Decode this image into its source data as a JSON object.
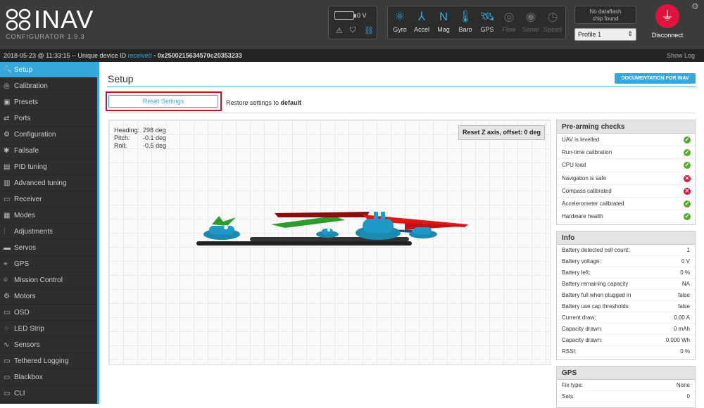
{
  "header": {
    "app_name": "INAV",
    "version": "CONFIGURATOR  1.9.3",
    "battery_voltage": "0 V",
    "sensors": [
      {
        "label": "Gyro",
        "icon": "gyro-icon",
        "glyph": "⚛",
        "active": true
      },
      {
        "label": "Accel",
        "icon": "accel-icon",
        "glyph": "⅄",
        "active": true
      },
      {
        "label": "Mag",
        "icon": "mag-icon",
        "glyph": "N",
        "active": true
      },
      {
        "label": "Baro",
        "icon": "baro-icon",
        "glyph": "🌡",
        "active": true
      },
      {
        "label": "GPS",
        "icon": "gps-icon",
        "glyph": "🛰",
        "active": true
      },
      {
        "label": "Flow",
        "icon": "flow-icon",
        "glyph": "◎",
        "active": false
      },
      {
        "label": "Sonar",
        "icon": "sonar-icon",
        "glyph": "◉",
        "active": false
      },
      {
        "label": "Speed",
        "icon": "speed-icon",
        "glyph": "◷",
        "active": false
      }
    ],
    "dataflash_line1": "No dataflash",
    "dataflash_line2": "chip found",
    "profile_selected": "Profile 1",
    "disconnect_label": "Disconnect",
    "accent_color": "#37a8db",
    "disconnect_color": "#e2123f"
  },
  "log": {
    "timestamp": "2018-05-23 @ 11:33:15 -- Unique device ID ",
    "received": "received",
    "device_id": " - 0x2500215634570c20353233",
    "show_log": "Show Log"
  },
  "sidebar": {
    "items": [
      {
        "label": "Setup",
        "icon": "wrench-icon",
        "glyph": "🔧",
        "active": true
      },
      {
        "label": "Calibration",
        "icon": "calibration-icon",
        "glyph": "◎"
      },
      {
        "label": "Presets",
        "icon": "presets-icon",
        "glyph": "▣"
      },
      {
        "label": "Ports",
        "icon": "ports-icon",
        "glyph": "⇄"
      },
      {
        "label": "Configuration",
        "icon": "gear-icon",
        "glyph": "⚙"
      },
      {
        "label": "Failsafe",
        "icon": "failsafe-icon",
        "glyph": "✱"
      },
      {
        "label": "PID tuning",
        "icon": "pid-icon",
        "glyph": "▤"
      },
      {
        "label": "Advanced tuning",
        "icon": "advanced-tuning-icon",
        "glyph": "▥"
      },
      {
        "label": "Receiver",
        "icon": "receiver-icon",
        "glyph": "▭"
      },
      {
        "label": "Modes",
        "icon": "modes-icon",
        "glyph": "▦"
      },
      {
        "label": "Adjustments",
        "icon": "adjustments-icon",
        "glyph": "⫶"
      },
      {
        "label": "Servos",
        "icon": "servos-icon",
        "glyph": "▬"
      },
      {
        "label": "GPS",
        "icon": "gps-nav-icon",
        "glyph": "⌖"
      },
      {
        "label": "Mission Control",
        "icon": "mission-control-icon",
        "glyph": "⌾"
      },
      {
        "label": "Motors",
        "icon": "motors-icon",
        "glyph": "⚙"
      },
      {
        "label": "OSD",
        "icon": "osd-icon",
        "glyph": "▭"
      },
      {
        "label": "LED Strip",
        "icon": "led-strip-icon",
        "glyph": "⁘"
      },
      {
        "label": "Sensors",
        "icon": "sensors-icon",
        "glyph": "∿"
      },
      {
        "label": "Tethered Logging",
        "icon": "tethered-logging-icon",
        "glyph": "▭"
      },
      {
        "label": "Blackbox",
        "icon": "blackbox-icon",
        "glyph": "▭"
      },
      {
        "label": "CLI",
        "icon": "cli-icon",
        "glyph": "▭"
      }
    ]
  },
  "main": {
    "title": "Setup",
    "doc_button": "DOCUMENTATION FOR INAV",
    "reset_button": "Reset Settings",
    "restore_text": "Restore settings to ",
    "restore_default": "default",
    "attitude": [
      {
        "label": "Heading:",
        "value": "298 deg"
      },
      {
        "label": "Pitch:",
        "value": "-0.1 deg"
      },
      {
        "label": "Roll:",
        "value": "-0.5 deg"
      }
    ],
    "reset_z_button": "Reset Z axis, offset: 0 deg"
  },
  "prearming": {
    "title": "Pre-arming checks",
    "checks": [
      {
        "label": "UAV is levelled",
        "ok": true,
        "symbol": "✓"
      },
      {
        "label": "Run-time calibration",
        "ok": true,
        "symbol": "✓"
      },
      {
        "label": "CPU load",
        "ok": true,
        "symbol": "✓"
      },
      {
        "label": "Navigation is safe",
        "ok": false,
        "symbol": "✕"
      },
      {
        "label": "Compass calibrated",
        "ok": false,
        "symbol": "✕"
      },
      {
        "label": "Accelerometer calibrated",
        "ok": true,
        "symbol": "✓"
      },
      {
        "label": "Hardware health",
        "ok": true,
        "symbol": "✓"
      }
    ]
  },
  "info": {
    "title": "Info",
    "rows": [
      {
        "label": "Battery detected cell count:",
        "value": "1"
      },
      {
        "label": "Battery voltage:",
        "value": "0 V"
      },
      {
        "label": "Battery left:",
        "value": "0 %"
      },
      {
        "label": "Battery remaining capacity",
        "value": "NA"
      },
      {
        "label": "Battery full when plugged in",
        "value": "false"
      },
      {
        "label": "Battery use cap thresholds",
        "value": "false"
      },
      {
        "label": "Current draw:",
        "value": "0.00 A"
      },
      {
        "label": "Capacity drawn:",
        "value": "0 mAh"
      },
      {
        "label": "Capacity drawn:",
        "value": "0.000 Wh"
      },
      {
        "label": "RSSI:",
        "value": "0 %"
      }
    ]
  },
  "gps": {
    "title": "GPS",
    "rows": [
      {
        "label": "Fix type:",
        "value": "None"
      },
      {
        "label": "Sats:",
        "value": "0"
      }
    ]
  }
}
